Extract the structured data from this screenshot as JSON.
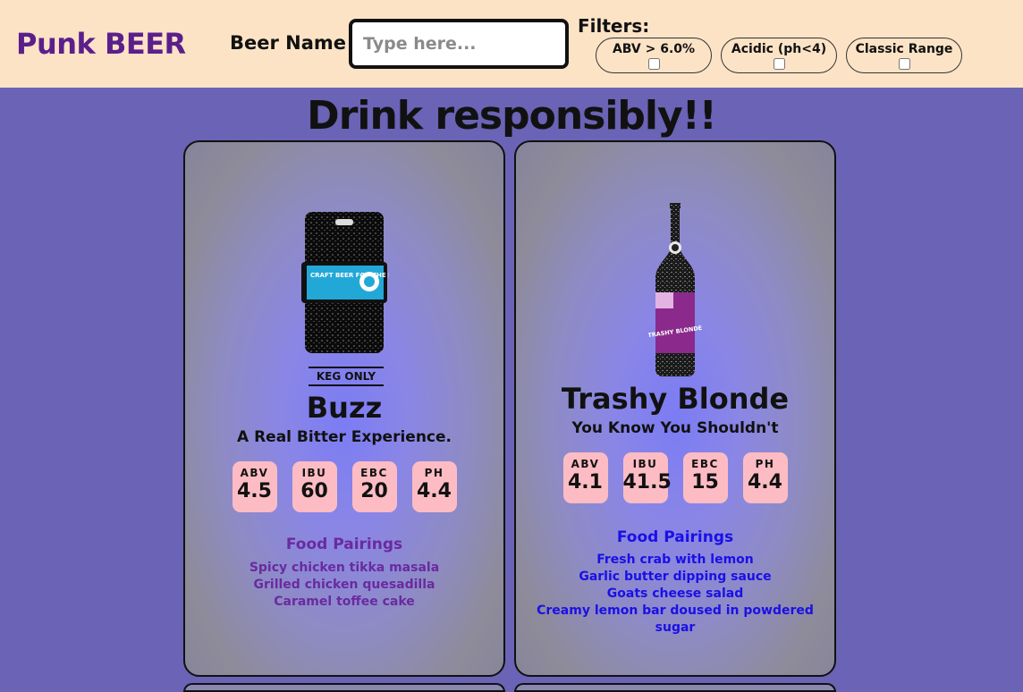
{
  "header": {
    "brand": "Punk BEER",
    "beer_name_label": "Beer Name",
    "search_placeholder": "Type here...",
    "filters_label": "Filters:",
    "filters": [
      {
        "label": "ABV > 6.0%",
        "checked": false
      },
      {
        "label": "Acidic (ph<4)",
        "checked": false
      },
      {
        "label": "Classic Range",
        "checked": false
      }
    ]
  },
  "headline": "Drink responsibly!!",
  "beers": [
    {
      "name": "Buzz",
      "tag": "KEG ONLY",
      "tagline": "A Real Bitter Experience.",
      "bottle_label_text": "CRAFT BEER FOR THE PEOPLE",
      "stats": [
        {
          "key": "ABV",
          "value": "4.5"
        },
        {
          "key": "IBU",
          "value": "60"
        },
        {
          "key": "EBC",
          "value": "20"
        },
        {
          "key": "PH",
          "value": "4.4"
        }
      ],
      "food_pairings_title": "Food Pairings",
      "food_pairings": [
        "Spicy chicken tikka masala",
        "Grilled chicken quesadilla",
        "Caramel toffee cake"
      ]
    },
    {
      "name": "Trashy Blonde",
      "tagline": "You Know You Shouldn't",
      "bottle_label_text": "TRASHY BLONDE",
      "stats": [
        {
          "key": "ABV",
          "value": "4.1"
        },
        {
          "key": "IBU",
          "value": "41.5"
        },
        {
          "key": "EBC",
          "value": "15"
        },
        {
          "key": "PH",
          "value": "4.4"
        }
      ],
      "food_pairings_title": "Food Pairings",
      "food_pairings": [
        "Fresh crab with lemon",
        "Garlic butter dipping sauce",
        "Goats cheese salad",
        "Creamy lemon bar doused in powdered sugar"
      ]
    }
  ],
  "colors": {
    "header_bg": "#fde3c6",
    "page_bg": "#6a63b6",
    "brand": "#5b1f8c",
    "stat_badge": "#fdbcc4",
    "pairing_purple": "#6a2aa0",
    "pairing_blue": "#1a10e6"
  }
}
